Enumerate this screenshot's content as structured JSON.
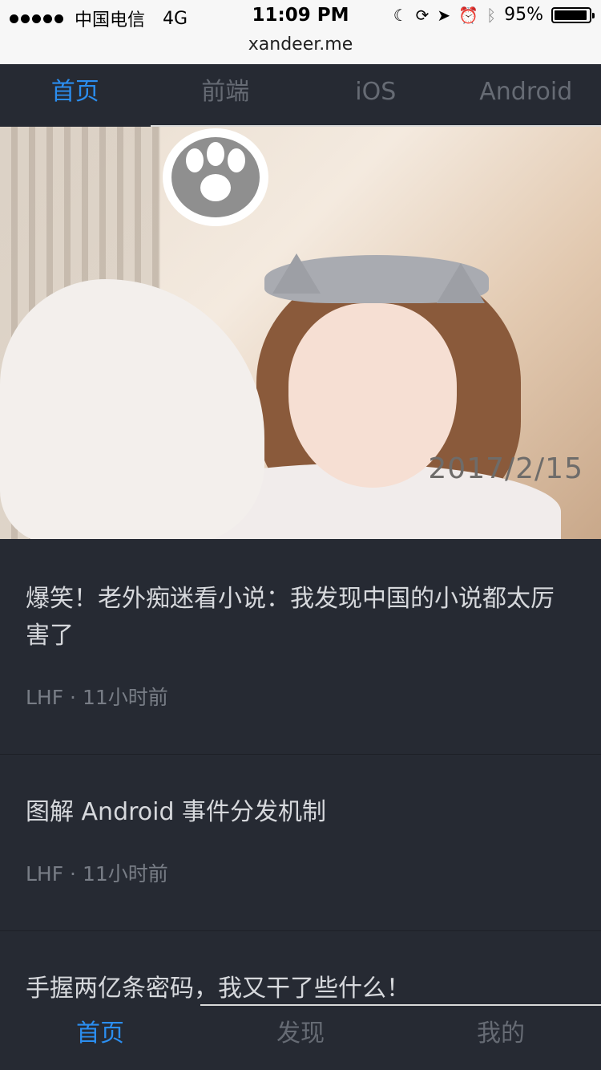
{
  "status_bar": {
    "carrier": "中国电信",
    "network": "4G",
    "time": "11:09 PM",
    "battery": "95%",
    "battery_level": 0.95,
    "icons": [
      "moon-icon",
      "rotation-lock-icon",
      "location-icon",
      "alarm-icon",
      "bluetooth-icon"
    ]
  },
  "browser": {
    "url": "xandeer.me"
  },
  "top_tabs": [
    {
      "label": "首页",
      "active": true
    },
    {
      "label": "前端",
      "active": false
    },
    {
      "label": "iOS",
      "active": false
    },
    {
      "label": "Android",
      "active": false
    }
  ],
  "hero": {
    "date": "2017/2/15"
  },
  "articles": [
    {
      "title": "爆笑！老外痴迷看小说：我发现中国的小说都太厉害了",
      "meta": "LHF · 11小时前"
    },
    {
      "title": "图解 Android 事件分发机制",
      "meta": "LHF · 11小时前"
    },
    {
      "title": "手握两亿条密码，我又干了些什么！",
      "meta": ""
    }
  ],
  "bottom_tabs": [
    {
      "label": "首页",
      "active": true
    },
    {
      "label": "发现",
      "active": false
    },
    {
      "label": "我的",
      "active": false
    }
  ],
  "colors": {
    "background": "#262a33",
    "accent": "#2b8ef0",
    "inactive": "#666b74",
    "status_bar": "#f7f7f7"
  }
}
